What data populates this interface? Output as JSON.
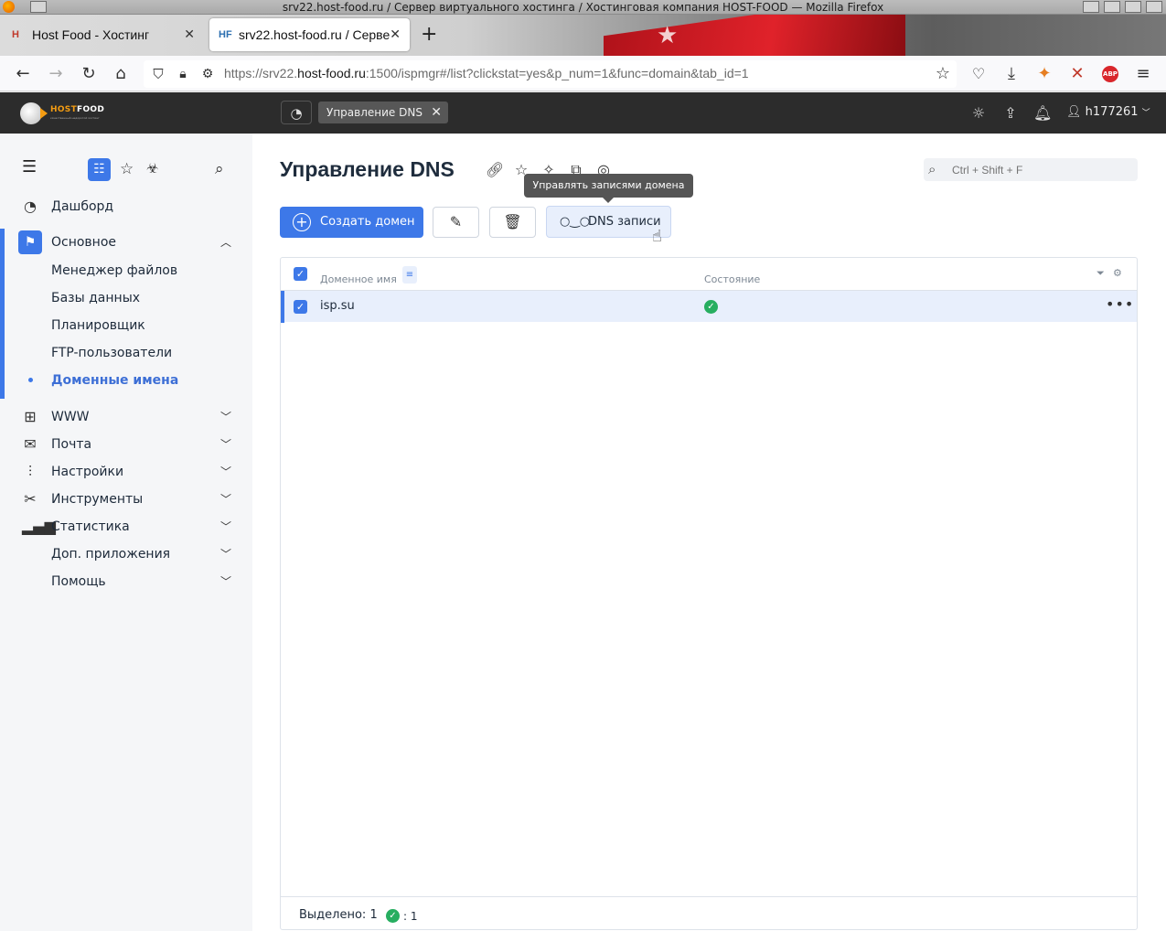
{
  "window": {
    "title": "srv22.host-food.ru / Сервер виртуального хостинга / Хостинговая компания HOST-FOOD — Mozilla Firefox"
  },
  "browser": {
    "tabs": [
      {
        "label": "Host Food - Хостинг",
        "favicon": "H"
      },
      {
        "label": "srv22.host-food.ru / Серве",
        "favicon": "HF"
      }
    ],
    "url_prefix": "https://srv22.",
    "url_domain": "host-food.ru",
    "url_suffix": ":1500/ispmgr#/list?clickstat=yes&p_num=1&func=domain&tab_id=1",
    "abp_label": "ABP"
  },
  "header": {
    "logo_host": "HOST",
    "logo_food": "FOOD",
    "logo_sub": "качественный недорогой хостинг",
    "chip_label": "Управление DNS",
    "user": "h177261"
  },
  "sidebar": {
    "items": [
      {
        "label": "Дашборд",
        "icon": "clock-icon"
      },
      {
        "label": "Основное",
        "icon": "flag-icon"
      },
      {
        "label": "WWW",
        "icon": "www-icon"
      },
      {
        "label": "Почта",
        "icon": "mail-icon"
      },
      {
        "label": "Настройки",
        "icon": "sliders-icon"
      },
      {
        "label": "Инструменты",
        "icon": "tools-icon"
      },
      {
        "label": "Статистика",
        "icon": "chart-icon"
      },
      {
        "label": "Доп. приложения",
        "icon": ""
      },
      {
        "label": "Помощь",
        "icon": ""
      }
    ],
    "subitems": [
      {
        "label": "Менеджер файлов"
      },
      {
        "label": "Базы данных"
      },
      {
        "label": "Планировщик"
      },
      {
        "label": "FTP-пользователи"
      },
      {
        "label": "Доменные имена",
        "selected": true
      }
    ]
  },
  "main": {
    "title": "Управление DNS",
    "search_placeholder": "Ctrl + Shift + F",
    "tooltip": "Управлять записями домена",
    "toolbar": {
      "create_label": "Создать домен",
      "dns_label": "DNS записи"
    },
    "table": {
      "columns": [
        "Доменное имя",
        "Состояние"
      ],
      "rows": [
        {
          "name": "isp.su",
          "status": "ok"
        }
      ]
    },
    "footer": {
      "selected_label": "Выделено: 1",
      "ok_count": ": 1"
    }
  },
  "colors": {
    "accent": "#3d78e8",
    "ok": "#27ae60",
    "header_bg": "#2c2c2c"
  }
}
